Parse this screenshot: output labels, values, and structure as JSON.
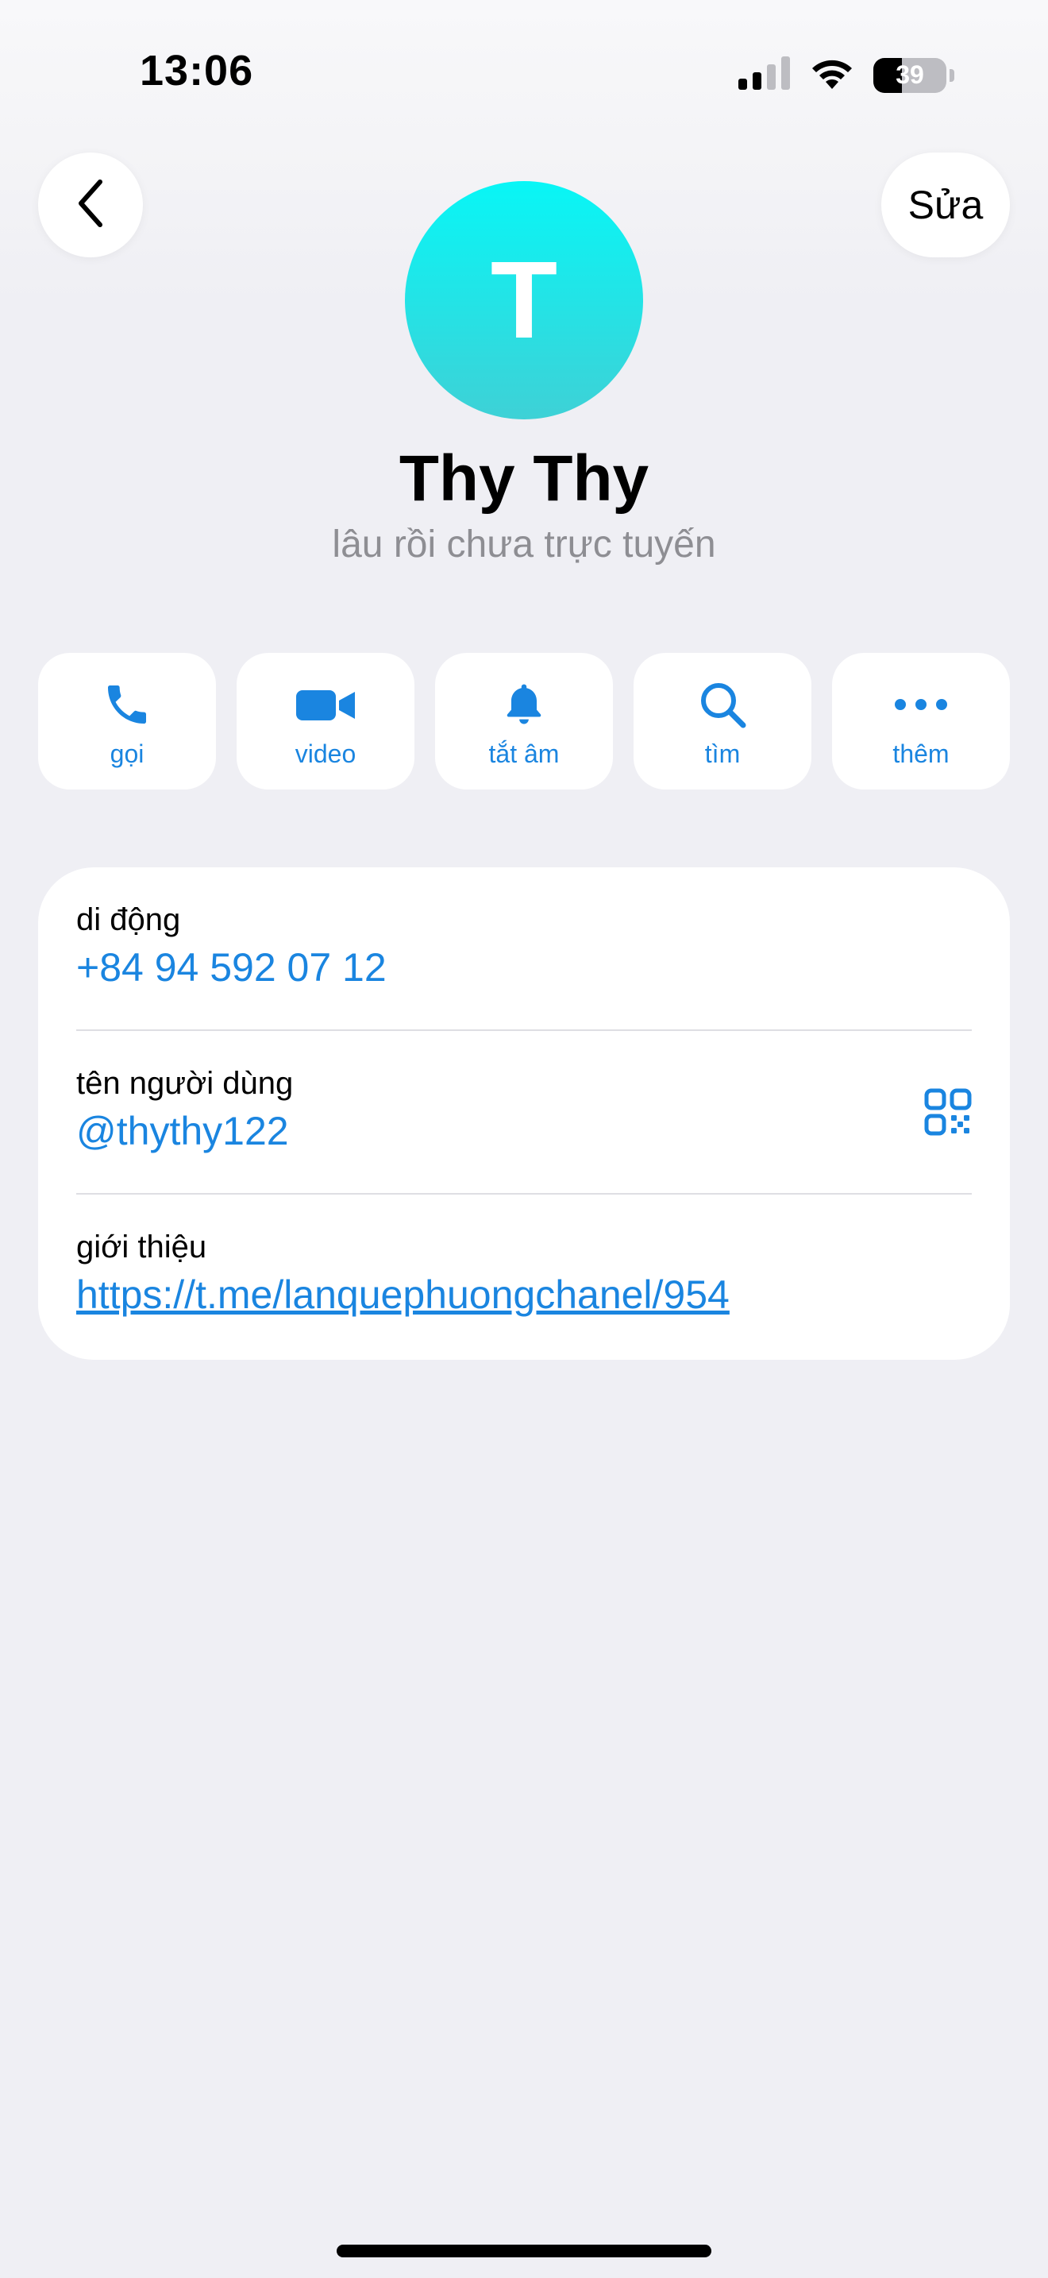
{
  "status_bar": {
    "time": "13:06",
    "battery_percent": 39,
    "battery_label": "39",
    "signal_icon": "cellular-signal-icon",
    "wifi_icon": "wifi-icon"
  },
  "header": {
    "back_icon": "chevron-left-icon",
    "edit_label": "Sửa"
  },
  "profile": {
    "avatar_letter": "T",
    "avatar_colors": [
      "#08f6f6",
      "#3ed1d6"
    ],
    "name": "Thy Thy",
    "status": "lâu rồi chưa trực tuyến"
  },
  "actions": [
    {
      "icon": "phone-icon",
      "label": "gọi"
    },
    {
      "icon": "video-camera-icon",
      "label": "video"
    },
    {
      "icon": "bell-icon",
      "label": "tắt âm"
    },
    {
      "icon": "search-icon",
      "label": "tìm"
    },
    {
      "icon": "more-dots-icon",
      "label": "thêm"
    }
  ],
  "info": {
    "mobile": {
      "label": "di động",
      "value": "+84 94 592 07 12"
    },
    "username": {
      "label": "tên người dùng",
      "value": "@thythy122",
      "icon": "qr-code-icon"
    },
    "bio": {
      "label": "giới thiệu",
      "value": "https://t.me/lanquephuongchanel/954"
    }
  },
  "colors": {
    "accent": "#1a85e0",
    "background": "#efeff4",
    "card": "#ffffff",
    "secondary_text": "#8e8e93"
  }
}
